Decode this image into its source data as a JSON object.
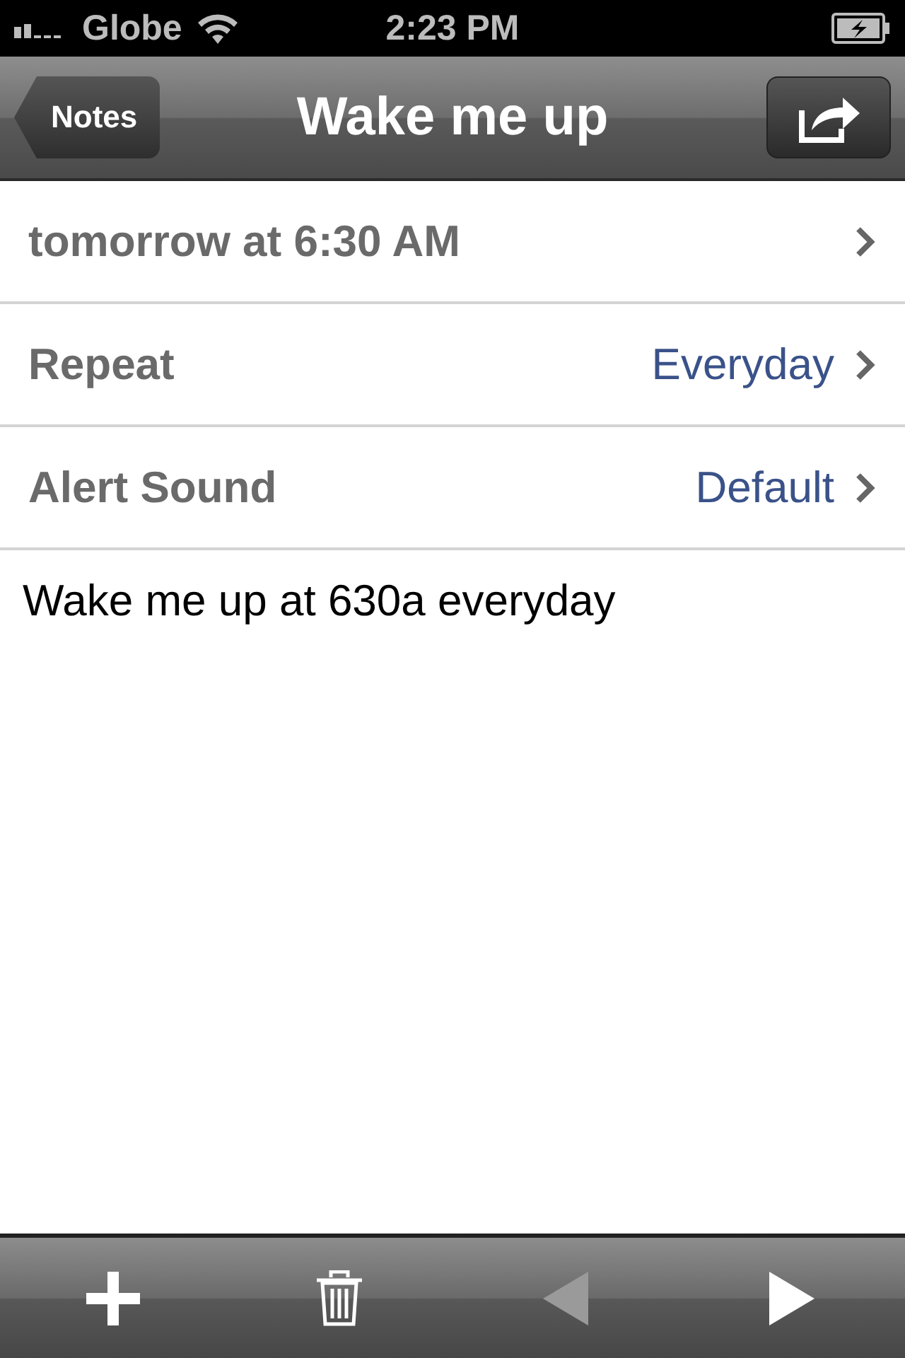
{
  "status_bar": {
    "carrier": "Globe",
    "time": "2:23 PM"
  },
  "nav_bar": {
    "back": "Notes",
    "title": "Wake me up"
  },
  "rows": [
    {
      "label": "tomorrow at 6:30 AM"
    },
    {
      "label": "Repeat",
      "value": "Everyday"
    },
    {
      "label": "Alert Sound",
      "value": "Default"
    }
  ],
  "note": "Wake me up at 630a everyday",
  "toolbar": [
    {
      "kind": "add",
      "disabled": false
    },
    {
      "kind": "trash",
      "disabled": false
    },
    {
      "kind": "previous",
      "disabled": true
    },
    {
      "kind": "next",
      "disabled": false
    }
  ]
}
